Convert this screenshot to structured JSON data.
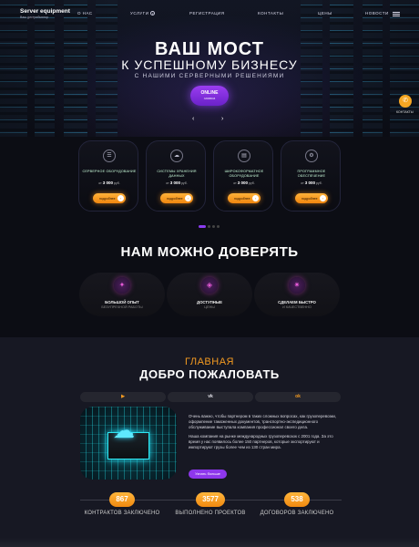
{
  "brand": {
    "name": "Server equipment",
    "tagline": "Ваш дистрибьютор"
  },
  "nav": {
    "items": [
      "О НАС",
      "УСЛУГИ",
      "РЕГИСТРАЦИЯ",
      "КОНТАКТЫ",
      "ЦЕНЫ",
      "НОВОСТИ"
    ],
    "menu_icon": "hamburger-icon",
    "dropdown_icon": "chevron-down-icon"
  },
  "hero": {
    "title": "ВАШ МОСТ",
    "subtitle": "К УСПЕШНОМУ БИЗНЕСУ",
    "tagline": "С НАШИМИ СЕРВЕРНЫМИ РЕШЕНИЯМИ",
    "button_line1": "ONLINE",
    "button_line2": "заявка",
    "prev_arrow": "‹",
    "next_arrow": "›",
    "contact_label": "КОНТАКТЫ"
  },
  "services": {
    "cards": [
      {
        "title": "СЕРВЕРНОЕ ОБОРУДОВАНИЕ",
        "price_prefix": "от",
        "price": "3 000",
        "currency": "руб.",
        "button": "подробнее",
        "icon": "server-icon"
      },
      {
        "title": "СИСТЕМЫ ХРАНЕНИЯ ДАННЫХ",
        "price_prefix": "от",
        "price": "3 000",
        "currency": "руб.",
        "button": "подробнее",
        "icon": "cloud-storage-icon"
      },
      {
        "title": "ШИРОКОФОРМАТНОЕ ОБОРУДОВАНИЕ",
        "price_prefix": "от",
        "price": "3 000",
        "currency": "руб.",
        "button": "подробнее",
        "icon": "printer-icon"
      },
      {
        "title": "ПРОГРАММНОЕ ОБЕСПЕЧЕНИЕ",
        "price_prefix": "от",
        "price": "3 000",
        "currency": "руб.",
        "button": "подробнее",
        "icon": "software-icon"
      }
    ],
    "carousel_active": 1,
    "carousel_total": 4
  },
  "trust": {
    "title": "НАМ МОЖНО ДОВЕРЯТЬ",
    "features": [
      {
        "title": "БОЛЬШОЙ ОПЫТ",
        "subtitle": "БЕЗУПРЕЧНОЙ РАБОТЫ",
        "icon": "team-icon"
      },
      {
        "title": "ДОСТУПНЫЕ",
        "subtitle": "ЦЕНЫ",
        "icon": "price-icon"
      },
      {
        "title": "СДЕЛАЕМ БЫСТРО",
        "subtitle": "И КАЧЕСТВЕННО",
        "icon": "quality-icon"
      }
    ]
  },
  "about": {
    "eyebrow": "ГЛАВНАЯ",
    "title": "ДОБРО ПОЖАЛОВАТЬ",
    "social": [
      {
        "label": "▶",
        "icon": "youtube-icon"
      },
      {
        "label": "vk",
        "icon": "vk-icon"
      },
      {
        "label": "ok",
        "icon": "odnoklassniki-icon"
      }
    ],
    "paragraph1": "Очень важно, чтобы партнером в таких сложных вопросах, как грузоперевозки, оформление таможенных документов, транспортно-экспедиционного обслуживание выступала компания профессионал своего дела.",
    "paragraph2": "Наша компания на рынке международных грузоперевозок с 2001 года. За это время у нас появилось более 150 партнеров, которые экспортируют и импортируют грузы более чем из 130 стран мира.",
    "button": "Узнать больше"
  },
  "stats": [
    {
      "value": "867",
      "label": "КОНТРАКТОВ ЗАКЛЮЧЕНО"
    },
    {
      "value": "3577",
      "label": "ВЫПОЛНЕНО ПРОЕКТОВ"
    },
    {
      "value": "538",
      "label": "ДОГОВОРОВ ЗАКЛЮЧЕНО"
    }
  ],
  "colors": {
    "accent_orange": "#f39a21",
    "accent_purple": "#8e37ec",
    "background": "#0c0d14"
  }
}
